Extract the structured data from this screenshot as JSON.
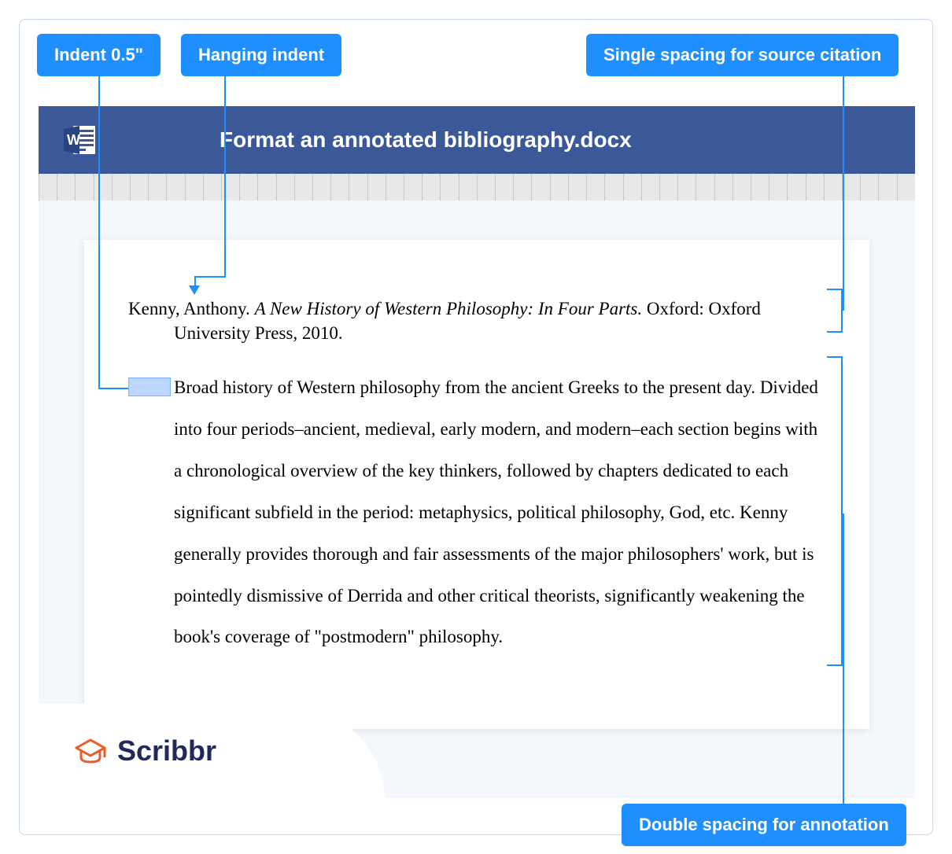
{
  "callouts": {
    "indent": "Indent 0.5\"",
    "hanging": "Hanging indent",
    "single_spacing": "Single spacing for source citation",
    "double_spacing": "Double spacing for annotation"
  },
  "header": {
    "title": "Format an annotated bibliography.docx"
  },
  "citation": {
    "author": "Kenny, Anthony. ",
    "title_italic": "A New History of Western Philosophy: In Four Parts.",
    "rest": " Oxford: Oxford University Press, 2010."
  },
  "annotation": "Broad history of Western philosophy from the ancient Greeks to the present day. Divided into four periods–ancient, medieval, early modern, and modern–each section begins with a chronological overview of the key thinkers, followed by chapters dedicated to each significant subfield in the period: metaphysics, political philosophy, God, etc. Kenny generally provides thorough and fair assessments of the major philosophers' work, but is pointedly dismissive of Derrida and other critical theorists, significantly weakening the book's coverage of \"postmodern\" philosophy.",
  "logo": {
    "text": "Scribbr"
  }
}
